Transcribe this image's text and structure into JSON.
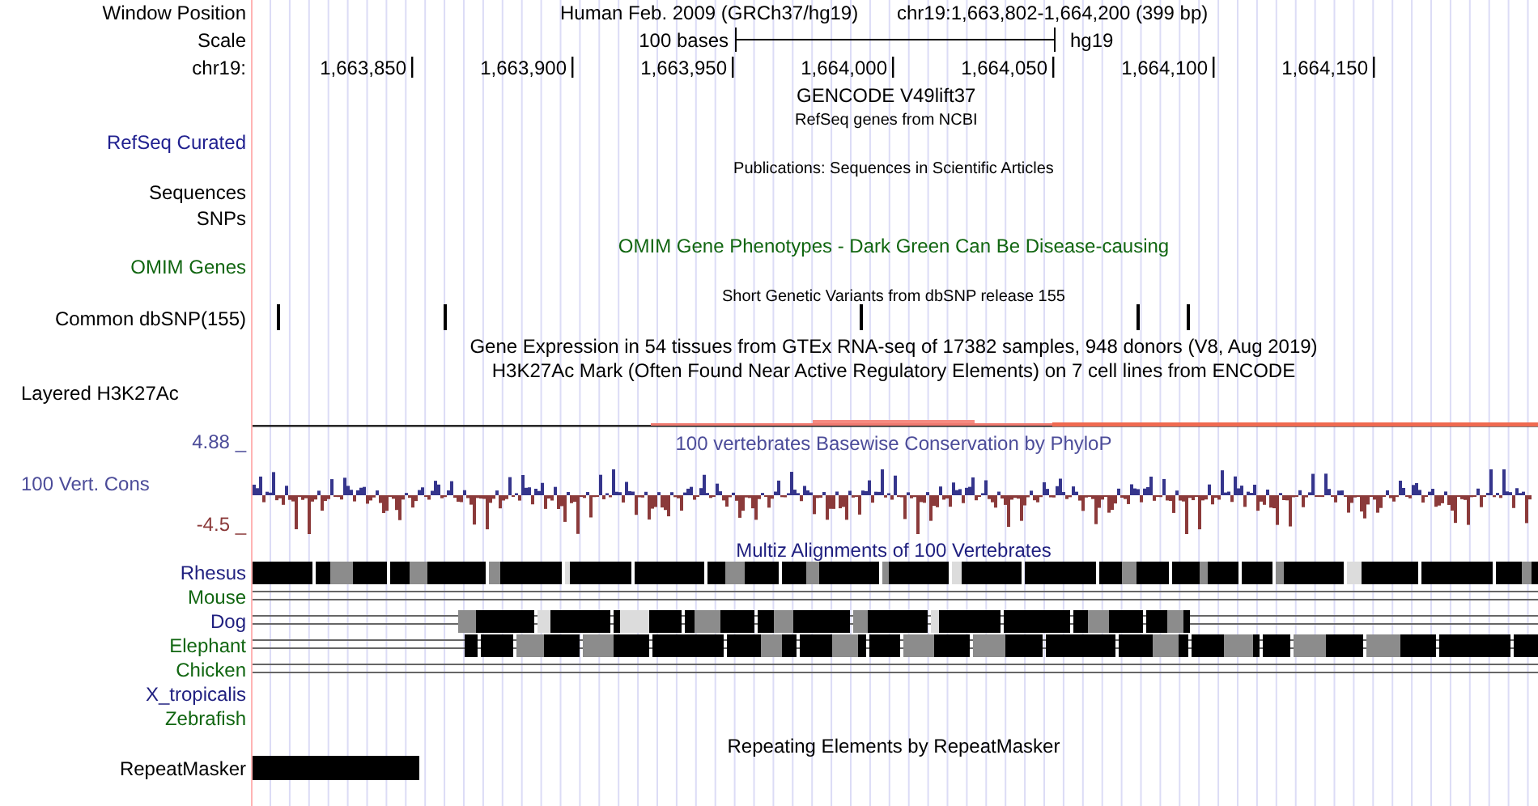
{
  "header": {
    "labels": [
      "Window Position",
      "Scale",
      "chr19:"
    ],
    "title": "Human Feb. 2009 (GRCh37/hg19)",
    "position": "chr19:1,663,802-1,664,200 (399 bp)",
    "scale_text": "100 bases",
    "assembly": "hg19"
  },
  "ruler": {
    "ticks": [
      "1,663,850",
      "1,663,900",
      "1,663,950",
      "1,664,000",
      "1,664,050",
      "1,664,100",
      "1,664,150"
    ]
  },
  "tracks": [
    {
      "label": "RefSeq Curated",
      "color": "#1f1f8f"
    },
    {
      "label": "Sequences",
      "color": "#000000"
    },
    {
      "label": "SNPs",
      "color": "#000000"
    },
    {
      "label": "OMIM Genes",
      "color": "#116611"
    },
    {
      "label": "Common dbSNP(155)",
      "color": "#000000"
    },
    {
      "label": "Layered H3K27Ac",
      "color": "#000000"
    },
    {
      "label": "100 Vert. Cons",
      "color": "#4c4c99"
    }
  ],
  "track_titles": [
    {
      "text": "GENCODE V49lift37",
      "color": "#000000"
    },
    {
      "text": "RefSeq genes from NCBI",
      "color": "#000000"
    },
    {
      "text": "Publications: Sequences in Scientific Articles",
      "color": "#000000"
    },
    {
      "text": "OMIM Gene Phenotypes - Dark Green Can Be Disease-causing",
      "color": "#116611"
    },
    {
      "text": "Short Genetic Variants from dbSNP release 155",
      "color": "#000000"
    },
    {
      "text": "Gene Expression in 54 tissues from GTEx RNA-seq of 17382 samples, 948 donors (V8, Aug 2019)",
      "color": "#000000"
    },
    {
      "text": "H3K27Ac Mark (Often Found Near Active Regulatory Elements) on 7 cell lines from ENCODE",
      "color": "#000000"
    },
    {
      "text": "100 vertebrates Basewise Conservation by PhyloP",
      "color": "#4c4c99"
    },
    {
      "text": "Multiz Alignments of 100 Vertebrates",
      "color": "#1f1f7f"
    },
    {
      "text": "Repeating Elements by RepeatMasker",
      "color": "#000000"
    }
  ],
  "conservation": {
    "axis_labels": [
      {
        "text": "4.88 _",
        "color": "#4c4c99"
      },
      {
        "text": "-4.5 _",
        "color": "#8b3a3a"
      }
    ]
  },
  "species": [
    {
      "name": "Rhesus",
      "color": "#1f1f7f"
    },
    {
      "name": "Mouse",
      "color": "#116611"
    },
    {
      "name": "Dog",
      "color": "#1f1f7f"
    },
    {
      "name": "Elephant",
      "color": "#116611"
    },
    {
      "name": "Chicken",
      "color": "#116611"
    },
    {
      "name": "X_tropicalis",
      "color": "#1f1f7f"
    },
    {
      "name": "Zebrafish",
      "color": "#116611"
    }
  ],
  "repeat_track": {
    "label": "RepeatMasker",
    "color": "#000000"
  }
}
